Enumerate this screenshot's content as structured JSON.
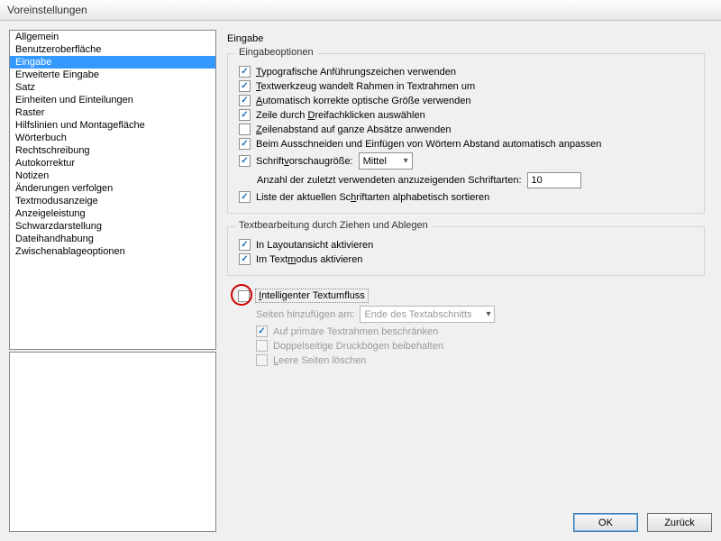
{
  "window_title": "Voreinstellungen",
  "sidebar": {
    "items": [
      "Allgemein",
      "Benutzeroberfläche",
      "Eingabe",
      "Erweiterte Eingabe",
      "Satz",
      "Einheiten und Einteilungen",
      "Raster",
      "Hilfslinien und Montagefläche",
      "Wörterbuch",
      "Rechtschreibung",
      "Autokorrektur",
      "Notizen",
      "Änderungen verfolgen",
      "Textmodusanzeige",
      "Anzeigeleistung",
      "Schwarzdarstellung",
      "Dateihandhabung",
      "Zwischenablageoptionen"
    ],
    "selected_index": 2
  },
  "page": {
    "title": "Eingabe",
    "options_legend": "Eingabeoptionen",
    "opt_typographic": "ypografische Anführungszeichen verwenden",
    "opt_typographic_u": "T",
    "opt_textwerk1": "extwerkzeug wandelt Rahmen in Textrahmen um",
    "opt_textwerk_u": "T",
    "opt_auto": "utomatisch korrekte optische Größe verwenden",
    "opt_auto_u": "A",
    "opt_zeile_pre": "Zeile durch ",
    "opt_zeile_u": "D",
    "opt_zeile_post": "reifachklicken auswählen",
    "opt_zeilenabstand_u": "Z",
    "opt_zeilenabstand": "eilenabstand auf ganze Absätze anwenden",
    "opt_schneiden": "Beim Ausschneiden und Einfügen von Wörtern Abstand automatisch anpassen",
    "opt_vorschau_pre": "Schrift",
    "opt_vorschau_u": "v",
    "opt_vorschau_post": "orschaugröße:",
    "vorschau_value": "Mittel",
    "recent_label": "Anzahl der zuletzt verwendeten anzuzeigenden Schriftarten:",
    "recent_value": "10",
    "opt_sort_pre": "Liste der aktuellen Sc",
    "opt_sort_u": "h",
    "opt_sort_post": "riftarten alphabetisch sortieren",
    "drag_legend": "Textbearbeitung durch Ziehen und Ablegen",
    "drag_layout": "In Layoutansicht aktivieren",
    "drag_textmode_pre": "Im Text",
    "drag_textmode_u": "m",
    "drag_textmode_post": "odus aktivieren",
    "smart_u": "I",
    "smart_post": "ntelligenter Textumfluss",
    "pages_label": "Seiten hinzufügen am:",
    "pages_value": "Ende des Textabschnitts",
    "restrict": "Auf primäre Textrahmen beschränken",
    "double": "Doppelseitige Druckbögen beibehalten",
    "delete_pre": "",
    "delete_u": "L",
    "delete_post": "eere Seiten löschen"
  },
  "buttons": {
    "ok": "OK",
    "back": "Zurück"
  }
}
